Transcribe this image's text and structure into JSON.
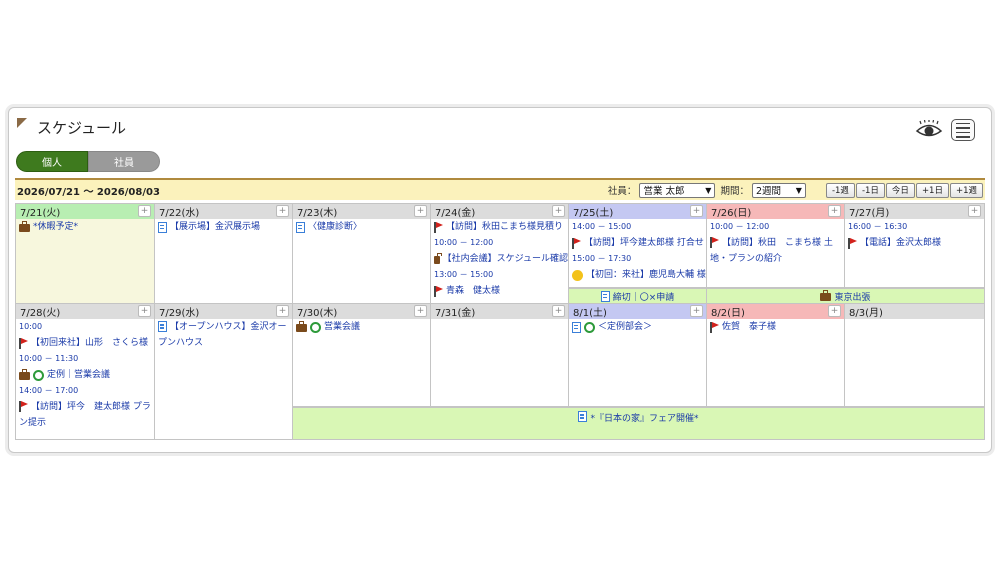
{
  "header": {
    "title": "スケジュール"
  },
  "icons": {
    "eye": "eye-icon",
    "menu": "menu-icon"
  },
  "toggle": {
    "personal": "個人",
    "staff": "社員"
  },
  "range_text": "2026/07/21 ～ 2026/08/03",
  "controls": {
    "employee_label": "社員：",
    "employee_value": "営業 太郎",
    "period_label": "期間：",
    "period_value": "2週間",
    "nav": [
      "-1週",
      "-1日",
      "今日",
      "+1日",
      "+1週"
    ]
  },
  "plus": "+",
  "week1": {
    "days": [
      {
        "label": "7/21(火)"
      },
      {
        "label": "7/22(水)"
      },
      {
        "label": "7/23(木)"
      },
      {
        "label": "7/24(金)"
      },
      {
        "label": "7/25(土)"
      },
      {
        "label": "7/26(日)"
      },
      {
        "label": "7/27(月)"
      }
    ],
    "d0": {
      "e0": "*休暇予定*"
    },
    "d1": {
      "e0": "【展示場】金沢展示場"
    },
    "d2": {
      "e0": "〈健康診断〉"
    },
    "d3": {
      "e0": "【訪問】秋田こまち様見積り",
      "t1": "10:00 － 12:00",
      "e1": "【社内会議】スケジュール確認",
      "t2": "13:00 － 15:00",
      "e2": "青森　健太様"
    },
    "d4": {
      "t0": "14:00 － 15:00",
      "e0": "【訪問】坪今建太郎様 打合せ",
      "t1": "15:00 － 17:30",
      "e1": "【初回：来社】鹿児島大輔 様"
    },
    "d5": {
      "t0": "10:00 － 12:00",
      "e0": "【訪問】秋田　こまち様 土地・プランの紹介"
    },
    "d6": {
      "t0": "16:00 － 16:30",
      "e0": "【電話】金沢太郎様"
    },
    "band1": "締切｜〇×申請",
    "band2": "東京出張"
  },
  "week2": {
    "days": [
      {
        "label": "7/28(火)"
      },
      {
        "label": "7/29(水)"
      },
      {
        "label": "7/30(木)"
      },
      {
        "label": "7/31(金)"
      },
      {
        "label": "8/1(土)"
      },
      {
        "label": "8/2(日)"
      },
      {
        "label": "8/3(月)"
      }
    ],
    "d0": {
      "t0": "10:00",
      "e0": "【初回来社】山形　さくら様",
      "t1": "10:00 － 11:30",
      "e1": "定例｜営業会議",
      "t2": "14:00 － 17:00",
      "e2": "【訪問】坪今　建太郎様 プラン提示"
    },
    "d1": {
      "e0": "【オープンハウス】金沢オープンハウス"
    },
    "d2": {
      "e0": "営業会議"
    },
    "d4": {
      "e0": "＜定例部会＞"
    },
    "d5": {
      "e0": "佐賀　泰子様"
    },
    "band1": "*『日本の家』フェア開催*"
  }
}
